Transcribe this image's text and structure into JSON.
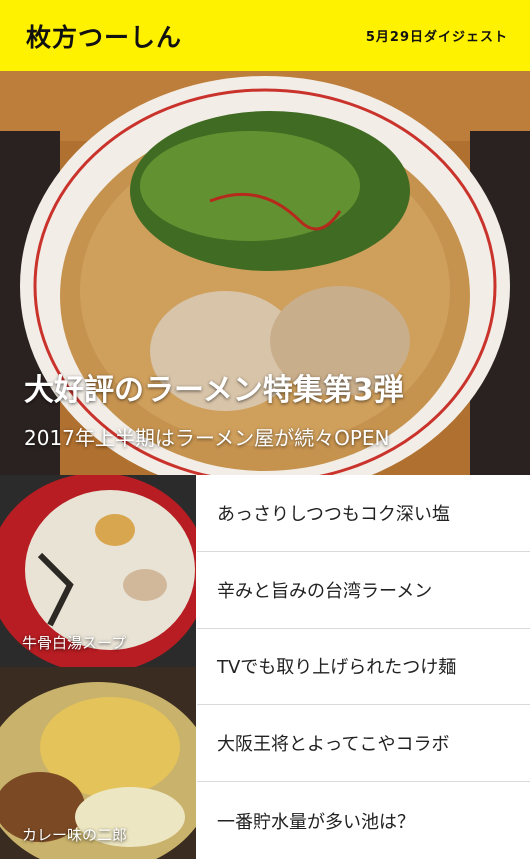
{
  "header": {
    "logo": "枚方つーしん",
    "digest": "5月29日ダイジェスト"
  },
  "hero": {
    "title": "大好評のラーメン特集第3弾",
    "subtitle": "2017年上半期はラーメン屋が続々OPEN",
    "image": "ramen-photo"
  },
  "thumbnails": [
    {
      "label": "牛骨白湯スープ",
      "image": "ramen-photo"
    },
    {
      "label": "カレー味の二郎",
      "image": "ramen-photo"
    }
  ],
  "articles": [
    "あっさりしつつもコク深い塩",
    "辛みと旨みの台湾ラーメン",
    "TVでも取り上げられたつけ麺",
    "大阪王将とよってこやコラボ",
    "一番貯水量が多い池は？"
  ],
  "colors": {
    "header_bg": "#fef200",
    "text": "#222222"
  }
}
